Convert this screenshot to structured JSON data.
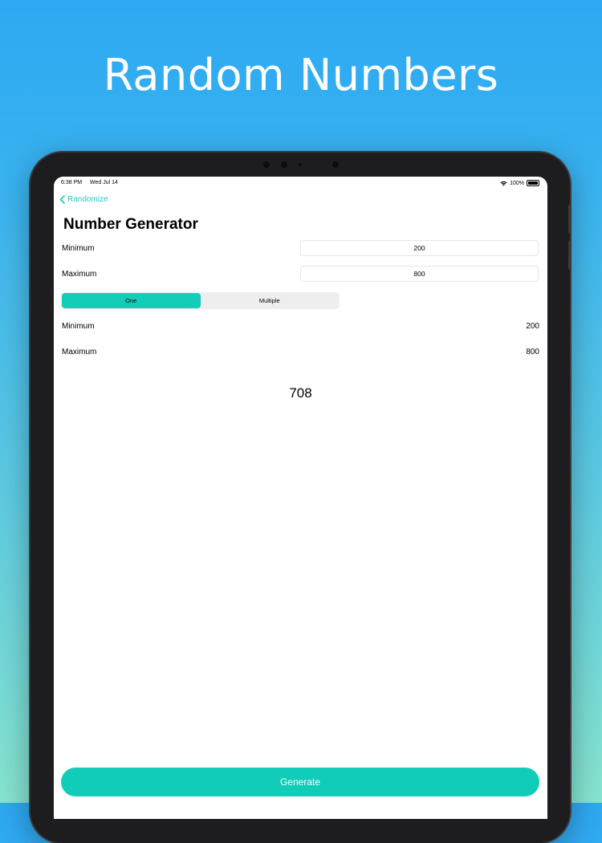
{
  "headline": "Random Numbers",
  "status_bar": {
    "time": "6:38 PM",
    "date": "Wed Jul 14",
    "battery": "100%"
  },
  "nav": {
    "back_label": "Randomize"
  },
  "page_title": "Number Generator",
  "inputs": {
    "minimum_label": "Minimum",
    "minimum_value": "200",
    "maximum_label": "Maximum",
    "maximum_value": "800"
  },
  "mode": {
    "options": [
      "One",
      "Multiple"
    ],
    "selected": "One"
  },
  "summary": {
    "minimum_label": "Minimum",
    "minimum_value": "200",
    "maximum_label": "Maximum",
    "maximum_value": "800"
  },
  "result": "708",
  "generate_label": "Generate",
  "colors": {
    "accent": "#14cdb8",
    "back_link": "#22c7bf",
    "background_top": "#2ea8f2",
    "background_bottom": "#86e4cf"
  }
}
